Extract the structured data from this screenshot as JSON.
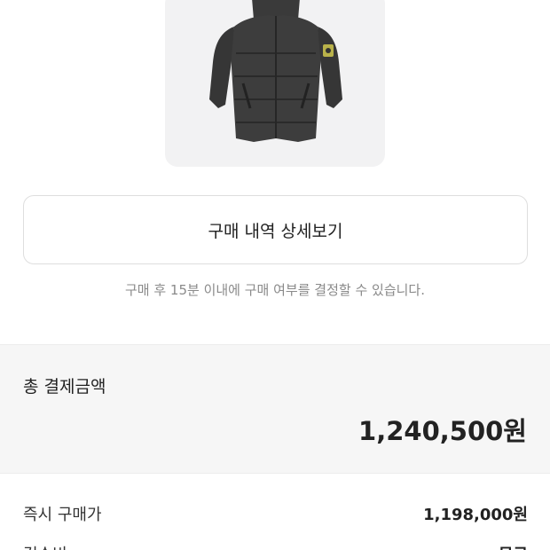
{
  "product": {
    "image_icon": "puffer-jacket-image"
  },
  "detail_button": {
    "label": "구매 내역 상세보기"
  },
  "notice": {
    "text": "구매 후 15분 이내에 구매 여부를 결정할 수 있습니다."
  },
  "total": {
    "label": "총 결제금액",
    "value": "1,240,500원"
  },
  "rows": [
    {
      "label": "즉시 구매가",
      "value": "1,198,000원"
    },
    {
      "label": "검수비",
      "value": "무료"
    }
  ]
}
